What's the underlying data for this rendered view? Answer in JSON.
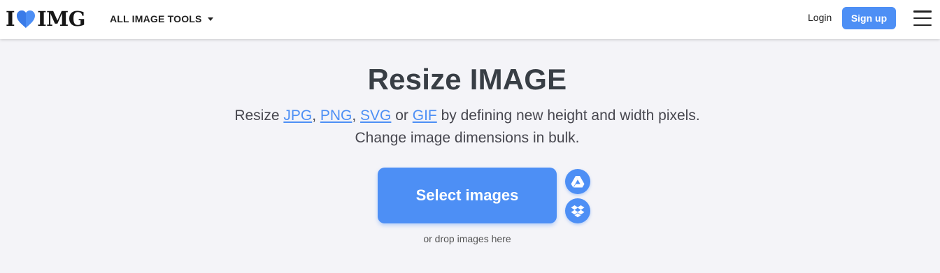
{
  "header": {
    "logo": {
      "left": "I",
      "right": "IMG"
    },
    "tools_menu_label": "ALL IMAGE TOOLS",
    "login_label": "Login",
    "signup_label": "Sign up"
  },
  "main": {
    "title": "Resize IMAGE",
    "subtitle": {
      "prefix": "Resize ",
      "formats": [
        "JPG",
        "PNG",
        "SVG",
        "GIF"
      ],
      "sep1": ", ",
      "sep2": ", ",
      "sep3": " or ",
      "suffix": " by defining new height and width pixels.",
      "line2": "Change image dimensions in bulk."
    },
    "select_button_label": "Select images",
    "cloud_sources": [
      "google-drive-icon",
      "dropbox-icon"
    ],
    "drop_hint": "or drop images here"
  },
  "colors": {
    "accent": "#4d8ff5",
    "background": "#f4f4f8",
    "header_bg": "#ffffff",
    "title": "#383e45"
  }
}
